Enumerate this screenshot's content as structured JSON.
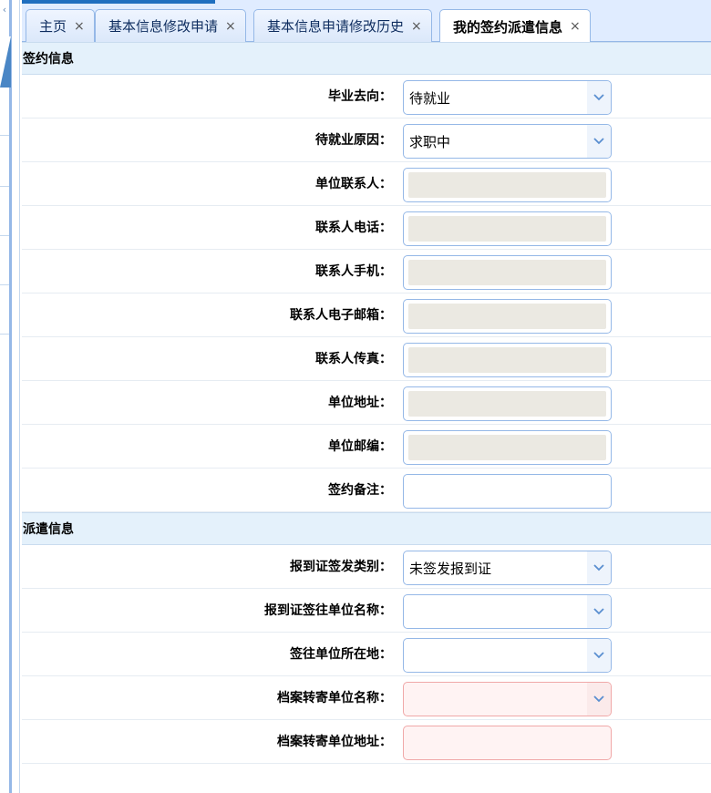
{
  "tabs": [
    {
      "label": "主页",
      "active": false
    },
    {
      "label": "基本信息修改申请",
      "active": false
    },
    {
      "label": "基本信息申请修改历史",
      "active": false
    },
    {
      "label": "我的签约派遣信息",
      "active": true
    }
  ],
  "close_glyph": "×",
  "sections": {
    "signing": {
      "title": "签约信息",
      "fields": [
        {
          "label": "毕业去向：",
          "value": "待就业",
          "type": "select"
        },
        {
          "label": "待就业原因：",
          "value": "求职中",
          "type": "select"
        },
        {
          "label": "单位联系人：",
          "value": "",
          "type": "disabled"
        },
        {
          "label": "联系人电话：",
          "value": "",
          "type": "disabled"
        },
        {
          "label": "联系人手机：",
          "value": "",
          "type": "disabled"
        },
        {
          "label": "联系人电子邮箱：",
          "value": "",
          "type": "disabled"
        },
        {
          "label": "联系人传真：",
          "value": "",
          "type": "disabled"
        },
        {
          "label": "单位地址：",
          "value": "",
          "type": "disabled"
        },
        {
          "label": "单位邮编：",
          "value": "",
          "type": "disabled"
        },
        {
          "label": "签约备注：",
          "value": "",
          "type": "text"
        }
      ]
    },
    "dispatch": {
      "title": "派遣信息",
      "fields": [
        {
          "label": "报到证签发类别：",
          "value": "未签发报到证",
          "type": "select"
        },
        {
          "label": "报到证签往单位名称：",
          "value": "",
          "type": "select"
        },
        {
          "label": "签往单位所在地：",
          "value": "",
          "type": "select"
        },
        {
          "label": "档案转寄单位名称：",
          "value": "",
          "type": "select-required"
        },
        {
          "label": "档案转寄单位地址：",
          "value": "",
          "type": "text-required"
        }
      ]
    }
  },
  "colors": {
    "tab_border": "#95b8e7",
    "section_bg": "#e4f1fb",
    "disabled_fill": "#ebe9e2",
    "required_border": "#f0a8a8"
  }
}
